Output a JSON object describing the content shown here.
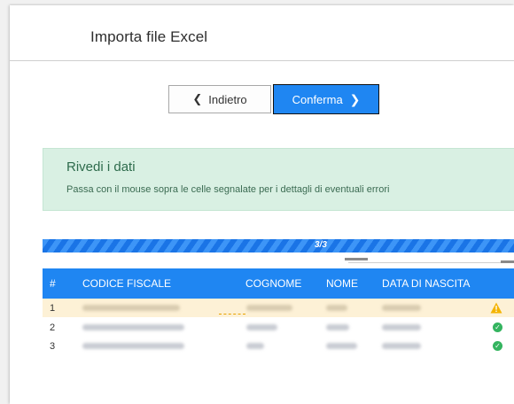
{
  "header": {
    "title": "Importa file Excel"
  },
  "buttons": {
    "back_label": "Indietro",
    "confirm_label": "Conferma"
  },
  "info": {
    "title": "Rivedi i dati",
    "subtitle": "Passa con il mouse sopra le celle segnalate per i dettagli di eventuali errori"
  },
  "progress": {
    "label": "3/3",
    "value": 3,
    "total": 3
  },
  "table": {
    "columns": [
      "#",
      "CODICE FISCALE",
      "COGNOME",
      "NOME",
      "DATA DI NASCITA"
    ],
    "rows": [
      {
        "index": "1",
        "status": "warning"
      },
      {
        "index": "2",
        "status": "ok"
      },
      {
        "index": "3",
        "status": "ok"
      }
    ]
  },
  "colors": {
    "accent": "#1f86f2",
    "info_bg": "#d9f0e3",
    "warning_row_bg": "#fdf1d6",
    "warning_icon": "#f4b400",
    "ok_icon": "#34b45f"
  },
  "icons": {
    "back": "chevron-left-icon",
    "confirm": "chevron-right-icon",
    "warning": "warning-triangle-icon",
    "ok": "check-circle-icon"
  }
}
